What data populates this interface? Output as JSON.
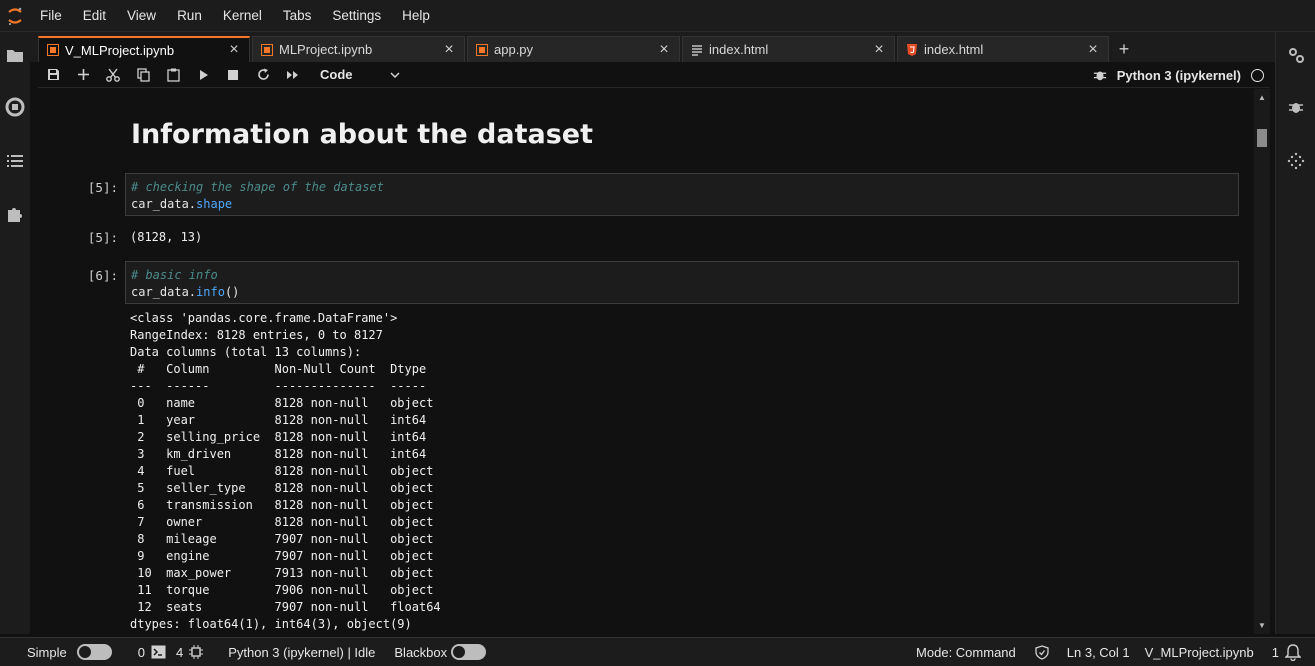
{
  "menu": [
    "File",
    "Edit",
    "View",
    "Run",
    "Kernel",
    "Tabs",
    "Settings",
    "Help"
  ],
  "tabs": [
    {
      "label": "V_MLProject.ipynb",
      "icon": "notebook-icon",
      "active": true
    },
    {
      "label": "MLProject.ipynb",
      "icon": "notebook-icon",
      "active": false
    },
    {
      "label": "app.py",
      "icon": "python-file-icon",
      "active": false
    },
    {
      "label": "index.html",
      "icon": "text-file-icon",
      "active": false
    },
    {
      "label": "index.html",
      "icon": "html-file-icon",
      "active": false
    }
  ],
  "toolbar": {
    "cell_type": "Code",
    "kernel_name": "Python 3 (ipykernel)"
  },
  "notebook": {
    "heading": "Information about the dataset",
    "cells": [
      {
        "prompt_in": "[5]:",
        "comment": "# checking the shape of the dataset",
        "code_var": "car_data.",
        "code_attr": "shape",
        "code_tail": "",
        "prompt_out": "[5]:",
        "output": "(8128, 13)"
      },
      {
        "prompt_in": "[6]:",
        "comment": "# basic info",
        "code_var": "car_data.",
        "code_attr": "info",
        "code_tail": "()",
        "output": "<class 'pandas.core.frame.DataFrame'>\nRangeIndex: 8128 entries, 0 to 8127\nData columns (total 13 columns):\n #   Column         Non-Null Count  Dtype  \n---  ------         --------------  -----  \n 0   name           8128 non-null   object \n 1   year           8128 non-null   int64  \n 2   selling_price  8128 non-null   int64  \n 3   km_driven      8128 non-null   int64  \n 4   fuel           8128 non-null   object \n 5   seller_type    8128 non-null   object \n 6   transmission   8128 non-null   object \n 7   owner          8128 non-null   object \n 8   mileage        7907 non-null   object \n 9   engine         7907 non-null   object \n 10  max_power      7913 non-null   object \n 11  torque         7906 non-null   object \n 12  seats          7907 non-null   float64\ndtypes: float64(1), int64(3), object(9)"
      }
    ]
  },
  "status": {
    "simple_label": "Simple",
    "terminals": "0",
    "kernels": "4",
    "kernel_state": "Python 3 (ipykernel) | Idle",
    "blackbox_label": "Blackbox",
    "mode": "Mode: Command",
    "cursor": "Ln 3, Col 1",
    "file": "V_MLProject.ipynb",
    "notifications": "1"
  },
  "colors": {
    "accent": "#f37726",
    "background": "#111111",
    "panel": "#1c1c1c",
    "comment": "#4d8a8a",
    "attribute": "#4fa8ff"
  }
}
